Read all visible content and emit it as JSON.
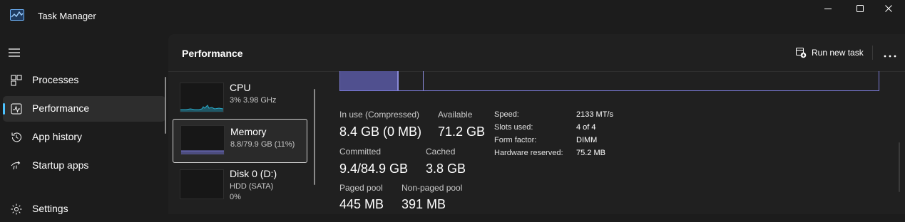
{
  "window": {
    "title": "Task Manager"
  },
  "nav": {
    "items": [
      {
        "label": "Processes",
        "icon": "processes-icon"
      },
      {
        "label": "Performance",
        "icon": "performance-icon",
        "active": true
      },
      {
        "label": "App history",
        "icon": "history-icon"
      },
      {
        "label": "Startup apps",
        "icon": "startup-icon"
      },
      {
        "label": "Settings",
        "icon": "gear-icon"
      }
    ]
  },
  "header": {
    "title": "Performance",
    "run_new_task": "Run new task",
    "more_icon": "ellipsis-icon"
  },
  "devices": [
    {
      "name": "CPU",
      "sub1": "3%  3.98 GHz",
      "sub2": ""
    },
    {
      "name": "Memory",
      "sub1": "8.8/79.9 GB (11%)",
      "sub2": "",
      "selected": true
    },
    {
      "name": "Disk 0 (D:)",
      "sub1": "HDD (SATA)",
      "sub2": "0%"
    }
  ],
  "memory": {
    "in_use_label": "In use (Compressed)",
    "in_use_value": "8.4 GB (0 MB)",
    "available_label": "Available",
    "available_value": "71.2 GB",
    "committed_label": "Committed",
    "committed_value": "9.4/84.9 GB",
    "cached_label": "Cached",
    "cached_value": "3.8 GB",
    "paged_pool_label": "Paged pool",
    "paged_pool_value": "445 MB",
    "nonpaged_pool_label": "Non-paged pool",
    "nonpaged_pool_value": "391 MB",
    "specs": [
      {
        "label": "Speed:",
        "value": "2133 MT/s"
      },
      {
        "label": "Slots used:",
        "value": "4 of 4"
      },
      {
        "label": "Form factor:",
        "value": "DIMM"
      },
      {
        "label": "Hardware reserved:",
        "value": "75.2 MB"
      }
    ]
  },
  "colors": {
    "accent": "#4cc2ff",
    "memory": "#7a7ad6",
    "cpu": "#2aa8c7"
  }
}
